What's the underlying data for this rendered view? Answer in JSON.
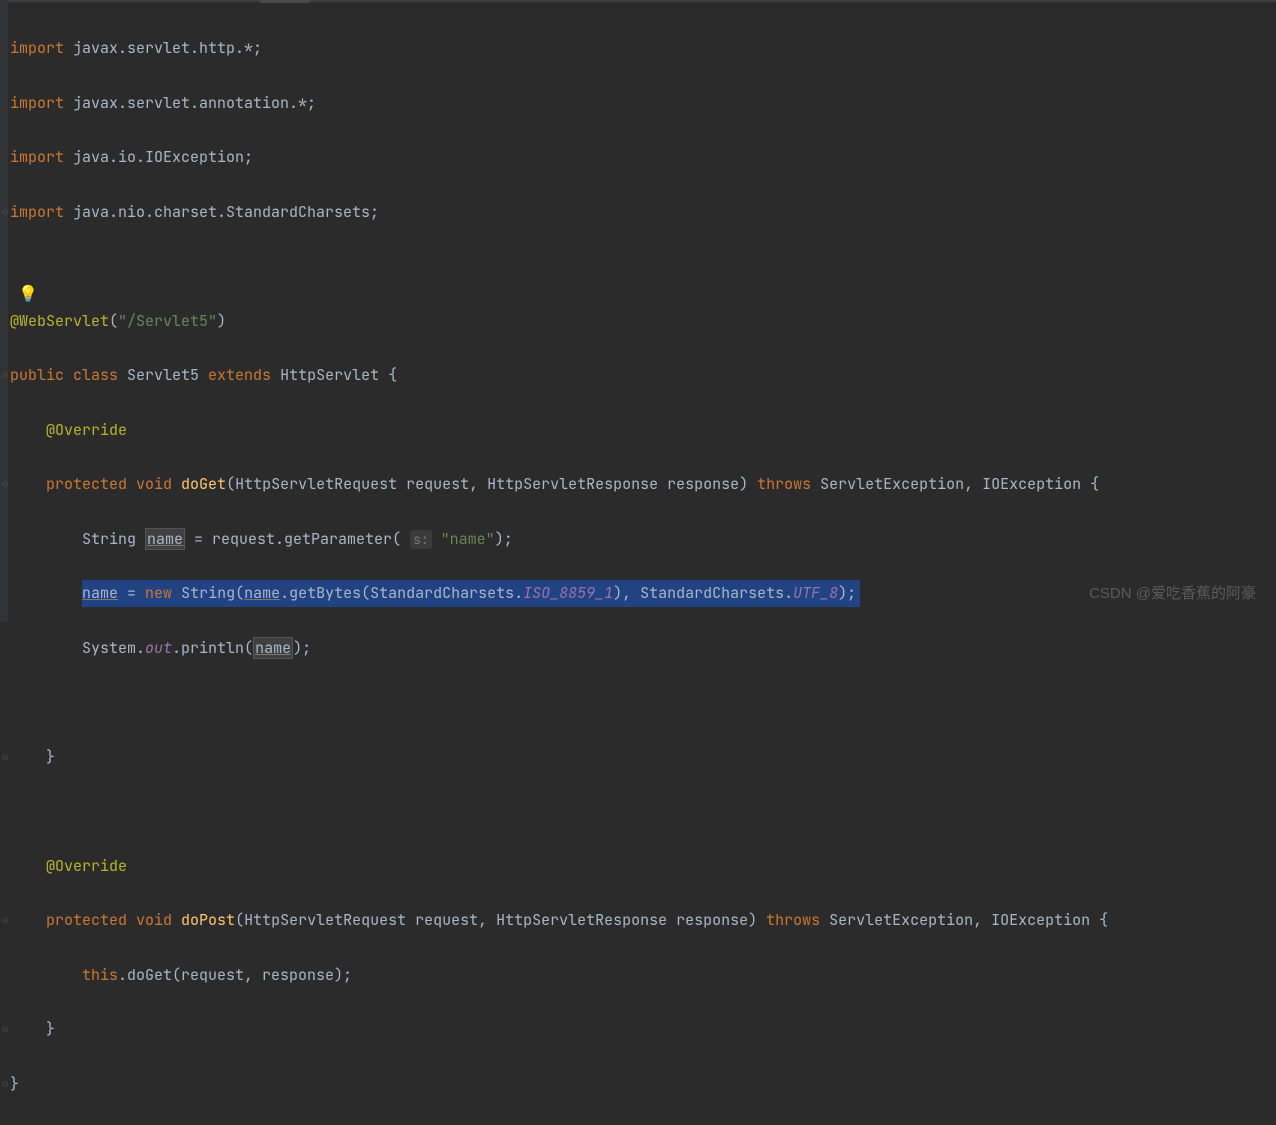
{
  "code": {
    "import1_kw": "import",
    "import1_pkg": " javax.servlet.http.*;",
    "import2_kw": "import",
    "import2_pkg": " javax.servlet.annotation.*;",
    "import3_kw": "import",
    "import3_pkg": " java.io.IOException;",
    "import4_kw": "import",
    "import4_pkg": " java.nio.charset.StandardCharsets;",
    "annotation_ws": "@WebServlet",
    "annotation_paren_open": "(",
    "annotation_value": "\"/Servlet5\"",
    "annotation_paren_close": ")",
    "public_kw": "public ",
    "class_kw": "class ",
    "class_name": "Servlet5 ",
    "extends_kw": "extends ",
    "super_class": "HttpServlet {",
    "override1": "@Override",
    "protected1": "protected ",
    "void1": "void ",
    "doGet": "doGet",
    "doGet_params": "(HttpServletRequest request, HttpServletResponse response) ",
    "throws1": "throws ",
    "exceptions1": "ServletException, IOException {",
    "line_string": "String ",
    "name1": "name",
    "eq_request": " = request.getParameter( ",
    "hint_s": "s:",
    "name_literal": " \"name\"",
    "close_paren1": ");",
    "name2": "name",
    "eq": " = ",
    "new_kw": "new ",
    "string_ctor": "String(",
    "name3": "name",
    "getBytes": ".getBytes(StandardCharsets.",
    "iso": "ISO_8859_1",
    "close_paren2": "), StandardCharsets.",
    "utf8": "UTF_8",
    "close_paren3": ");",
    "sysout1": "System.",
    "out1": "out",
    "println1": ".println(",
    "name4": "name",
    "close_paren4": ");",
    "brace1": "}",
    "override2": "@Override",
    "protected2": "protected ",
    "void2": "void ",
    "doPost": "doPost",
    "doPost_params": "(HttpServletRequest request, HttpServletResponse response) ",
    "throws2": "throws ",
    "exceptions2": "ServletException, IOException {",
    "this_kw": "this",
    "doGet_call": ".doGet(request, response);",
    "brace2": "}",
    "brace3": "}"
  },
  "watermark": "CSDN @爱吃香蕉的阿豪"
}
